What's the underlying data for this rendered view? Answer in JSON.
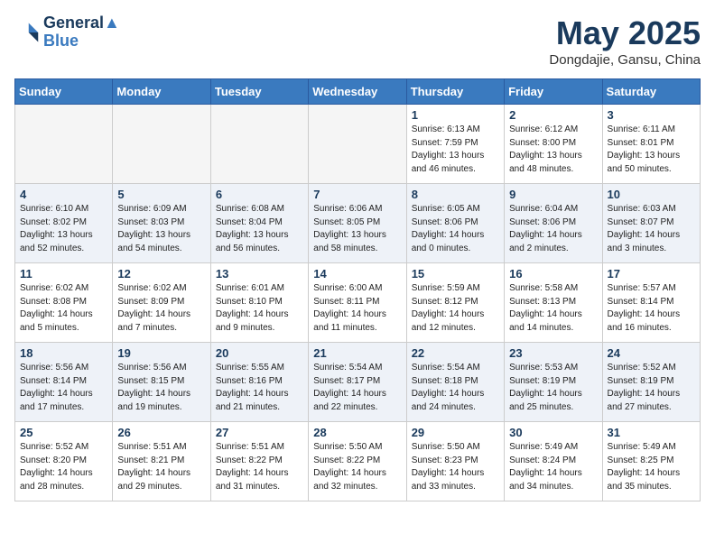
{
  "header": {
    "logo_line1": "General",
    "logo_line2": "Blue",
    "month_title": "May 2025",
    "location": "Dongdajie, Gansu, China"
  },
  "days_of_week": [
    "Sunday",
    "Monday",
    "Tuesday",
    "Wednesday",
    "Thursday",
    "Friday",
    "Saturday"
  ],
  "weeks": [
    [
      {
        "num": "",
        "info": ""
      },
      {
        "num": "",
        "info": ""
      },
      {
        "num": "",
        "info": ""
      },
      {
        "num": "",
        "info": ""
      },
      {
        "num": "1",
        "info": "Sunrise: 6:13 AM\nSunset: 7:59 PM\nDaylight: 13 hours\nand 46 minutes."
      },
      {
        "num": "2",
        "info": "Sunrise: 6:12 AM\nSunset: 8:00 PM\nDaylight: 13 hours\nand 48 minutes."
      },
      {
        "num": "3",
        "info": "Sunrise: 6:11 AM\nSunset: 8:01 PM\nDaylight: 13 hours\nand 50 minutes."
      }
    ],
    [
      {
        "num": "4",
        "info": "Sunrise: 6:10 AM\nSunset: 8:02 PM\nDaylight: 13 hours\nand 52 minutes."
      },
      {
        "num": "5",
        "info": "Sunrise: 6:09 AM\nSunset: 8:03 PM\nDaylight: 13 hours\nand 54 minutes."
      },
      {
        "num": "6",
        "info": "Sunrise: 6:08 AM\nSunset: 8:04 PM\nDaylight: 13 hours\nand 56 minutes."
      },
      {
        "num": "7",
        "info": "Sunrise: 6:06 AM\nSunset: 8:05 PM\nDaylight: 13 hours\nand 58 minutes."
      },
      {
        "num": "8",
        "info": "Sunrise: 6:05 AM\nSunset: 8:06 PM\nDaylight: 14 hours\nand 0 minutes."
      },
      {
        "num": "9",
        "info": "Sunrise: 6:04 AM\nSunset: 8:06 PM\nDaylight: 14 hours\nand 2 minutes."
      },
      {
        "num": "10",
        "info": "Sunrise: 6:03 AM\nSunset: 8:07 PM\nDaylight: 14 hours\nand 3 minutes."
      }
    ],
    [
      {
        "num": "11",
        "info": "Sunrise: 6:02 AM\nSunset: 8:08 PM\nDaylight: 14 hours\nand 5 minutes."
      },
      {
        "num": "12",
        "info": "Sunrise: 6:02 AM\nSunset: 8:09 PM\nDaylight: 14 hours\nand 7 minutes."
      },
      {
        "num": "13",
        "info": "Sunrise: 6:01 AM\nSunset: 8:10 PM\nDaylight: 14 hours\nand 9 minutes."
      },
      {
        "num": "14",
        "info": "Sunrise: 6:00 AM\nSunset: 8:11 PM\nDaylight: 14 hours\nand 11 minutes."
      },
      {
        "num": "15",
        "info": "Sunrise: 5:59 AM\nSunset: 8:12 PM\nDaylight: 14 hours\nand 12 minutes."
      },
      {
        "num": "16",
        "info": "Sunrise: 5:58 AM\nSunset: 8:13 PM\nDaylight: 14 hours\nand 14 minutes."
      },
      {
        "num": "17",
        "info": "Sunrise: 5:57 AM\nSunset: 8:14 PM\nDaylight: 14 hours\nand 16 minutes."
      }
    ],
    [
      {
        "num": "18",
        "info": "Sunrise: 5:56 AM\nSunset: 8:14 PM\nDaylight: 14 hours\nand 17 minutes."
      },
      {
        "num": "19",
        "info": "Sunrise: 5:56 AM\nSunset: 8:15 PM\nDaylight: 14 hours\nand 19 minutes."
      },
      {
        "num": "20",
        "info": "Sunrise: 5:55 AM\nSunset: 8:16 PM\nDaylight: 14 hours\nand 21 minutes."
      },
      {
        "num": "21",
        "info": "Sunrise: 5:54 AM\nSunset: 8:17 PM\nDaylight: 14 hours\nand 22 minutes."
      },
      {
        "num": "22",
        "info": "Sunrise: 5:54 AM\nSunset: 8:18 PM\nDaylight: 14 hours\nand 24 minutes."
      },
      {
        "num": "23",
        "info": "Sunrise: 5:53 AM\nSunset: 8:19 PM\nDaylight: 14 hours\nand 25 minutes."
      },
      {
        "num": "24",
        "info": "Sunrise: 5:52 AM\nSunset: 8:19 PM\nDaylight: 14 hours\nand 27 minutes."
      }
    ],
    [
      {
        "num": "25",
        "info": "Sunrise: 5:52 AM\nSunset: 8:20 PM\nDaylight: 14 hours\nand 28 minutes."
      },
      {
        "num": "26",
        "info": "Sunrise: 5:51 AM\nSunset: 8:21 PM\nDaylight: 14 hours\nand 29 minutes."
      },
      {
        "num": "27",
        "info": "Sunrise: 5:51 AM\nSunset: 8:22 PM\nDaylight: 14 hours\nand 31 minutes."
      },
      {
        "num": "28",
        "info": "Sunrise: 5:50 AM\nSunset: 8:22 PM\nDaylight: 14 hours\nand 32 minutes."
      },
      {
        "num": "29",
        "info": "Sunrise: 5:50 AM\nSunset: 8:23 PM\nDaylight: 14 hours\nand 33 minutes."
      },
      {
        "num": "30",
        "info": "Sunrise: 5:49 AM\nSunset: 8:24 PM\nDaylight: 14 hours\nand 34 minutes."
      },
      {
        "num": "31",
        "info": "Sunrise: 5:49 AM\nSunset: 8:25 PM\nDaylight: 14 hours\nand 35 minutes."
      }
    ]
  ]
}
